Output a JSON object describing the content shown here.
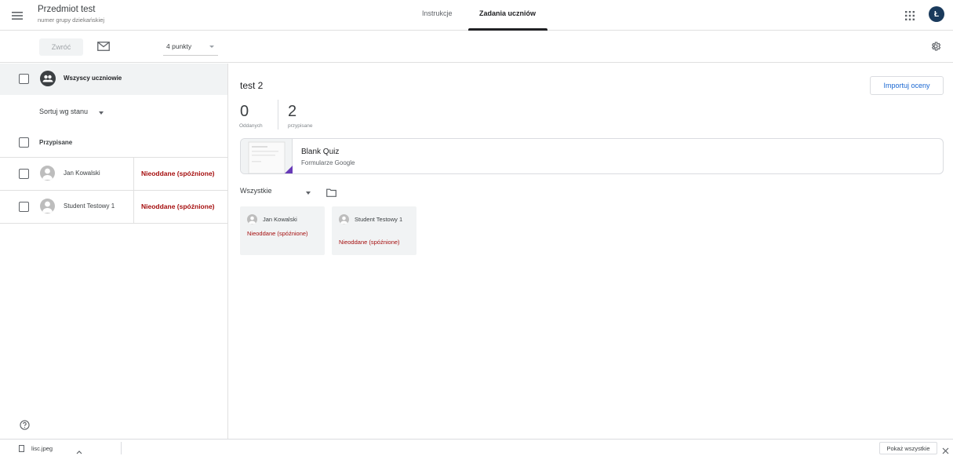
{
  "header": {
    "course_title": "Przedmiot test",
    "course_subtitle": "numer grupy dziekańskiej",
    "tabs": [
      {
        "label": "Instrukcje",
        "active": false
      },
      {
        "label": "Zadania uczniów",
        "active": true
      }
    ],
    "avatar_letter": "Ł",
    "avatar_color": "#1a3a5c"
  },
  "toolbar": {
    "return_label": "Zwróć",
    "points_value": "4 punkty"
  },
  "left_panel": {
    "all_students_label": "Wszyscy uczniowie",
    "sort_label": "Sortuj wg stanu",
    "assigned_label": "Przypisane",
    "students": [
      {
        "name": "Jan Kowalski",
        "status": "Nieoddane (spóźnione)"
      },
      {
        "name": "Student Testowy 1",
        "status": "Nieoddane (spóźnione)"
      }
    ]
  },
  "main": {
    "assignment_title": "test 2",
    "import_label": "Importuj oceny",
    "turned_in_count": "0",
    "turned_in_label": "Oddanych",
    "assigned_count": "2",
    "assigned_label": "przypisane",
    "attachment": {
      "title": "Blank Quiz",
      "subtitle": "Formularze Google",
      "accent_color": "#673ab7"
    },
    "filter_label": "Wszystkie",
    "cards": [
      {
        "name": "Jan Kowalski",
        "status": "Nieoddane (spóźnione)"
      },
      {
        "name": "Student Testowy 1",
        "status": "Nieoddane (spóźnione)"
      }
    ]
  },
  "downloads": {
    "file_name": "lisc.jpeg",
    "show_all_label": "Pokaż wszystkie"
  },
  "colors": {
    "late_status": "#a50e0e",
    "link_blue": "#1967d2"
  }
}
